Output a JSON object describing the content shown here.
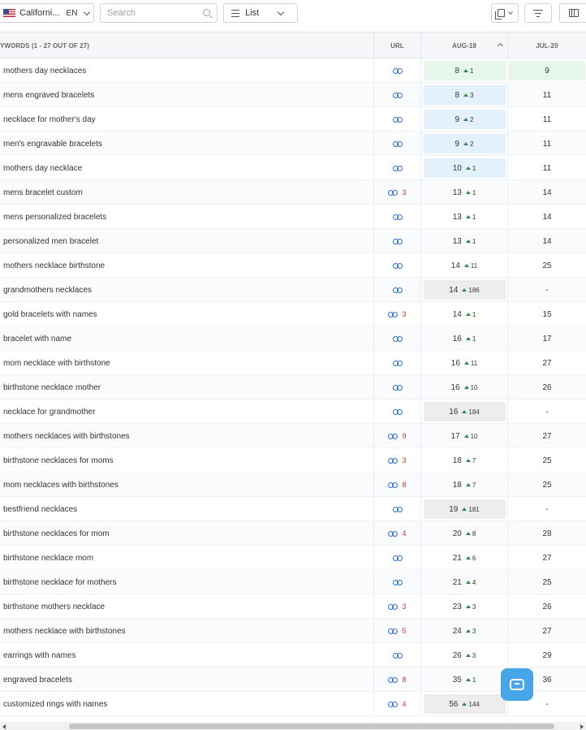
{
  "toolbar": {
    "location_label": "Californi...",
    "language": "EN",
    "search_placeholder": "Search",
    "view_label": "List"
  },
  "colors": {
    "accent": "#2b6fd6",
    "green_bg": "#e5f6ea",
    "blue_bg": "#e2f1fc",
    "gray_bg": "#ededed",
    "change_red": "#d0372b"
  },
  "table": {
    "headers": {
      "keywords": "YWORDS (1 - 27 OUT OF 27)",
      "url": "URL",
      "aug": "AUG-18",
      "jul": "JUL-20"
    },
    "rows": [
      {
        "keyword": "mothers day necklaces",
        "url_count": "",
        "aug_pos": "8",
        "aug_delta": "1",
        "aug_bg": "green",
        "jul": "9",
        "jul_bg": "green"
      },
      {
        "keyword": "mens engraved bracelets",
        "url_count": "",
        "aug_pos": "8",
        "aug_delta": "3",
        "aug_bg": "blue",
        "jul": "11",
        "jul_bg": ""
      },
      {
        "keyword": "necklace for mother's day",
        "url_count": "",
        "aug_pos": "9",
        "aug_delta": "2",
        "aug_bg": "blue",
        "jul": "11",
        "jul_bg": ""
      },
      {
        "keyword": "men's engravable bracelets",
        "url_count": "",
        "aug_pos": "9",
        "aug_delta": "2",
        "aug_bg": "blue",
        "jul": "11",
        "jul_bg": ""
      },
      {
        "keyword": "mothers day necklace",
        "url_count": "",
        "aug_pos": "10",
        "aug_delta": "1",
        "aug_bg": "blue",
        "jul": "11",
        "jul_bg": ""
      },
      {
        "keyword": "mens bracelet custom",
        "url_count": "3",
        "aug_pos": "13",
        "aug_delta": "1",
        "aug_bg": "",
        "jul": "14",
        "jul_bg": ""
      },
      {
        "keyword": "mens personalized bracelets",
        "url_count": "",
        "aug_pos": "13",
        "aug_delta": "1",
        "aug_bg": "",
        "jul": "14",
        "jul_bg": ""
      },
      {
        "keyword": "personalized men bracelet",
        "url_count": "",
        "aug_pos": "13",
        "aug_delta": "1",
        "aug_bg": "",
        "jul": "14",
        "jul_bg": ""
      },
      {
        "keyword": "mothers necklace birthstone",
        "url_count": "",
        "aug_pos": "14",
        "aug_delta": "11",
        "aug_bg": "",
        "jul": "25",
        "jul_bg": ""
      },
      {
        "keyword": "grandmothers necklaces",
        "url_count": "",
        "aug_pos": "14",
        "aug_delta": "186",
        "aug_bg": "gray",
        "jul": "-",
        "jul_bg": ""
      },
      {
        "keyword": "gold bracelets with names",
        "url_count": "3",
        "aug_pos": "14",
        "aug_delta": "1",
        "aug_bg": "",
        "jul": "15",
        "jul_bg": ""
      },
      {
        "keyword": "bracelet with name",
        "url_count": "",
        "aug_pos": "16",
        "aug_delta": "1",
        "aug_bg": "",
        "jul": "17",
        "jul_bg": ""
      },
      {
        "keyword": "mom necklace with birthstone",
        "url_count": "",
        "aug_pos": "16",
        "aug_delta": "11",
        "aug_bg": "",
        "jul": "27",
        "jul_bg": ""
      },
      {
        "keyword": "birthstone necklace mother",
        "url_count": "",
        "aug_pos": "16",
        "aug_delta": "10",
        "aug_bg": "",
        "jul": "26",
        "jul_bg": ""
      },
      {
        "keyword": "necklace for grandmother",
        "url_count": "",
        "aug_pos": "16",
        "aug_delta": "184",
        "aug_bg": "gray",
        "jul": "-",
        "jul_bg": ""
      },
      {
        "keyword": "mothers necklaces with birthstones",
        "url_count": "9",
        "aug_pos": "17",
        "aug_delta": "10",
        "aug_bg": "",
        "jul": "27",
        "jul_bg": ""
      },
      {
        "keyword": "birthstone necklaces for moms",
        "url_count": "3",
        "aug_pos": "18",
        "aug_delta": "7",
        "aug_bg": "",
        "jul": "25",
        "jul_bg": ""
      },
      {
        "keyword": "mom necklaces with birthstones",
        "url_count": "8",
        "aug_pos": "18",
        "aug_delta": "7",
        "aug_bg": "",
        "jul": "25",
        "jul_bg": ""
      },
      {
        "keyword": "bestfriend necklaces",
        "url_count": "",
        "aug_pos": "19",
        "aug_delta": "181",
        "aug_bg": "gray",
        "jul": "-",
        "jul_bg": ""
      },
      {
        "keyword": "birthstone necklaces for mom",
        "url_count": "4",
        "aug_pos": "20",
        "aug_delta": "8",
        "aug_bg": "",
        "jul": "28",
        "jul_bg": ""
      },
      {
        "keyword": "birthstone necklace mom",
        "url_count": "",
        "aug_pos": "21",
        "aug_delta": "6",
        "aug_bg": "",
        "jul": "27",
        "jul_bg": ""
      },
      {
        "keyword": "birthstone necklace for mothers",
        "url_count": "",
        "aug_pos": "21",
        "aug_delta": "4",
        "aug_bg": "",
        "jul": "25",
        "jul_bg": ""
      },
      {
        "keyword": "birthstone mothers necklace",
        "url_count": "3",
        "aug_pos": "23",
        "aug_delta": "3",
        "aug_bg": "",
        "jul": "26",
        "jul_bg": ""
      },
      {
        "keyword": "mothers necklace with birthstones",
        "url_count": "5",
        "aug_pos": "24",
        "aug_delta": "3",
        "aug_bg": "",
        "jul": "27",
        "jul_bg": ""
      },
      {
        "keyword": "earrings with names",
        "url_count": "",
        "aug_pos": "26",
        "aug_delta": "3",
        "aug_bg": "",
        "jul": "29",
        "jul_bg": ""
      },
      {
        "keyword": "engraved bracelets",
        "url_count": "8",
        "aug_pos": "35",
        "aug_delta": "1",
        "aug_bg": "",
        "jul": "36",
        "jul_bg": ""
      },
      {
        "keyword": "customized rings with names",
        "url_count": "4",
        "aug_pos": "56",
        "aug_delta": "144",
        "aug_bg": "gray",
        "jul": "-",
        "jul_bg": ""
      }
    ]
  }
}
